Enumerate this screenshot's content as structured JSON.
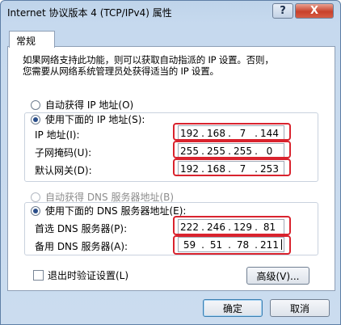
{
  "window": {
    "title": "Internet 协议版本 4 (TCP/IPv4) 属性",
    "help_label": "?",
    "close_label": "X"
  },
  "tabs": [
    {
      "label": "常规"
    }
  ],
  "description": [
    "如果网络支持此功能，则可以获取自动指派的 IP 设置。否则，",
    "您需要从网络系统管理员处获得适当的 IP 设置。"
  ],
  "ip_section": {
    "auto_label": "自动获得 IP 地址(O)",
    "manual_label": "使用下面的 IP 地址(S):",
    "selected": "manual",
    "fields": [
      {
        "label": "IP 地址(I):",
        "octets": [
          "192",
          "168",
          "7",
          "144"
        ]
      },
      {
        "label": "子网掩码(U):",
        "octets": [
          "255",
          "255",
          "255",
          "0"
        ]
      },
      {
        "label": "默认网关(D):",
        "octets": [
          "192",
          "168",
          "7",
          "253"
        ]
      }
    ]
  },
  "dns_section": {
    "auto_label": "自动获得 DNS 服务器地址(B)",
    "manual_label": "使用下面的 DNS 服务器地址(E):",
    "selected": "manual",
    "fields": [
      {
        "label": "首选 DNS 服务器(P):",
        "octets": [
          "222",
          "246",
          "129",
          "81"
        ]
      },
      {
        "label": "备用 DNS 服务器(A):",
        "octets": [
          "59",
          "51",
          "78",
          "211"
        ]
      }
    ]
  },
  "validate_checkbox": {
    "label": "退出时验证设置(L)",
    "checked": false
  },
  "buttons": {
    "advanced": "高级(V)...",
    "ok": "确定",
    "cancel": "取消"
  },
  "colors": {
    "highlight": "#d9232e"
  }
}
